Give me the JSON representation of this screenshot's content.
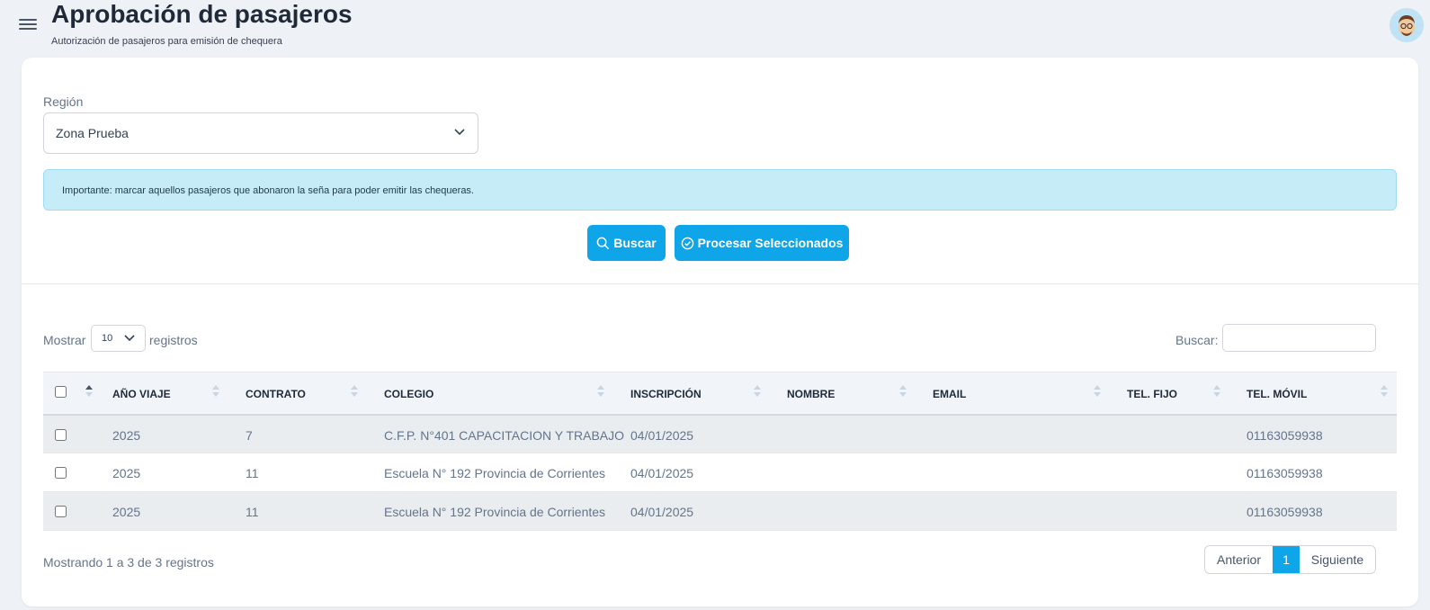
{
  "header": {
    "title": "Aprobación de pasajeros",
    "subtitle": "Autorización de pasajeros para emisión de chequera"
  },
  "filters": {
    "region_label": "Región",
    "region_value": "Zona Prueba"
  },
  "alert": "Importante: marcar aquellos pasajeros que abonaron la seña para poder emitir las chequeras.",
  "buttons": {
    "buscar": "Buscar",
    "procesar": "Procesar Seleccionados"
  },
  "table_controls": {
    "show_label": "Mostrar",
    "page_length": "10",
    "records_label": "registros",
    "search_label": "Buscar:",
    "search_value": ""
  },
  "table": {
    "columns": [
      "AÑO VIAJE",
      "CONTRATO",
      "COLEGIO",
      "INSCRIPCIÓN",
      "NOMBRE",
      "EMAIL",
      "TEL. FIJO",
      "TEL. MÓVIL"
    ],
    "rows": [
      {
        "anio": "2025",
        "contrato": "7",
        "colegio": "C.F.P. N°401 CAPACITACION Y TRABAJO",
        "inscripcion": "04/01/2025",
        "nombre": "",
        "email": "",
        "tel_fijo": "",
        "tel_movil": "01163059938"
      },
      {
        "anio": "2025",
        "contrato": "11",
        "colegio": "Escuela N° 192 Provincia de Corrientes",
        "inscripcion": "04/01/2025",
        "nombre": "",
        "email": "",
        "tel_fijo": "",
        "tel_movil": "01163059938"
      },
      {
        "anio": "2025",
        "contrato": "11",
        "colegio": "Escuela N° 192 Provincia de Corrientes",
        "inscripcion": "04/01/2025",
        "nombre": "",
        "email": "",
        "tel_fijo": "",
        "tel_movil": "01163059938"
      }
    ]
  },
  "footer": {
    "info": "Mostrando 1 a 3 de 3 registros",
    "prev": "Anterior",
    "page": "1",
    "next": "Siguiente"
  },
  "colors": {
    "accent": "#0ea5e9",
    "alert_bg": "#c6ecf8",
    "page_bg": "#eef1f5"
  },
  "icons": [
    "menu-icon",
    "avatar-icon",
    "chevron-down-icon",
    "search-icon",
    "check-circle-icon",
    "sort-icon"
  ]
}
